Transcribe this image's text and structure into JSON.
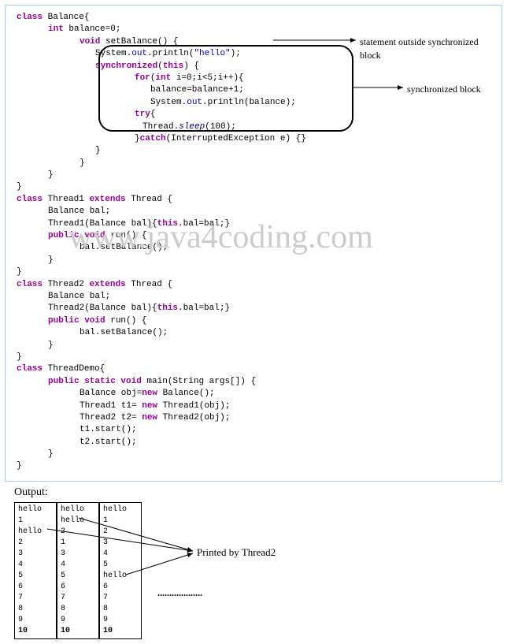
{
  "annotations": {
    "outside_block": "statement outside synchronized block",
    "sync_block": "synchronized block",
    "printed_by": "Printed by Thread2",
    "dots": "..................."
  },
  "watermark": "www.java4coding.com",
  "output_label": "Output:",
  "code": {
    "c01a": "class",
    "c01b": " Balance{",
    "c02a": "int",
    "c02b": " balance=0;",
    "c03a": "void",
    "c03b": " setBalance() {",
    "c04a": "System.",
    "c04b": "out",
    "c04c": ".println(",
    "c04d": "\"hello\"",
    "c04e": ");",
    "c05a": "synchronized",
    "c05b": "(",
    "c05c": "this",
    "c05d": ") {",
    "c06a": "for",
    "c06b": "(",
    "c06c": "int",
    "c06d": " i=0;i<5;i++){",
    "c07a": "balance=balance+1;",
    "c08a": "System.",
    "c08b": "out",
    "c08c": ".println(balance);",
    "c09a": "try",
    "c09b": "{",
    "c10a": "Thread.",
    "c10b": "sleep",
    "c10c": "(100);",
    "c11a": "}",
    "c11b": "catch",
    "c11c": "(InterruptedException e) {}",
    "c12": "}",
    "c13": "}",
    "c14": "}",
    "c15": "}",
    "t1a": "class",
    "t1b": " Thread1 ",
    "t1c": "extends",
    "t1d": " Thread  {",
    "t1e": "Balance bal;",
    "t1f": "Thread1(Balance bal){",
    "t1g": "this",
    "t1h": ".bal=bal;}",
    "t1i": "public void",
    "t1j": " run() {",
    "t1k": "bal.setBalance();",
    "t1l": "}",
    "t1m": "}",
    "t2a": "class",
    "t2b": " Thread2 ",
    "t2c": "extends",
    "t2d": " Thread  {",
    "t2e": "Balance bal;",
    "t2f": "Thread2(Balance bal){",
    "t2g": "this",
    "t2h": ".bal=bal;}",
    "t2i": "public void",
    "t2j": " run() {",
    "t2k": "bal.setBalance();",
    "t2l": "}",
    "t2m": "}",
    "d1a": "class",
    "d1b": " ThreadDemo{",
    "d2a": "public static void",
    "d2b": " main(String args[]) {",
    "d3a": "Balance obj=",
    "d3b": "new",
    "d3c": " Balance();",
    "d4a": "Thread1 t1= ",
    "d4b": "new",
    "d4c": " Thread1(obj);",
    "d5a": "Thread2 t2= ",
    "d5b": "new",
    "d5c": " Thread2(obj);",
    "d6": "t1.start();",
    "d7": "t2.start();",
    "d8": "}",
    "d9": "}"
  },
  "output_columns": [
    [
      "hello",
      "1",
      "hello",
      "2",
      "3",
      "4",
      "5",
      "6",
      "7",
      "8",
      "9",
      "10"
    ],
    [
      "hello",
      "hello",
      "2",
      "1",
      "3",
      "4",
      "5",
      "6",
      "7",
      "8",
      "9",
      "10"
    ],
    [
      "hello",
      "1",
      "2",
      "3",
      "4",
      "5",
      "hello",
      "6",
      "7",
      "8",
      "9",
      "10"
    ]
  ]
}
